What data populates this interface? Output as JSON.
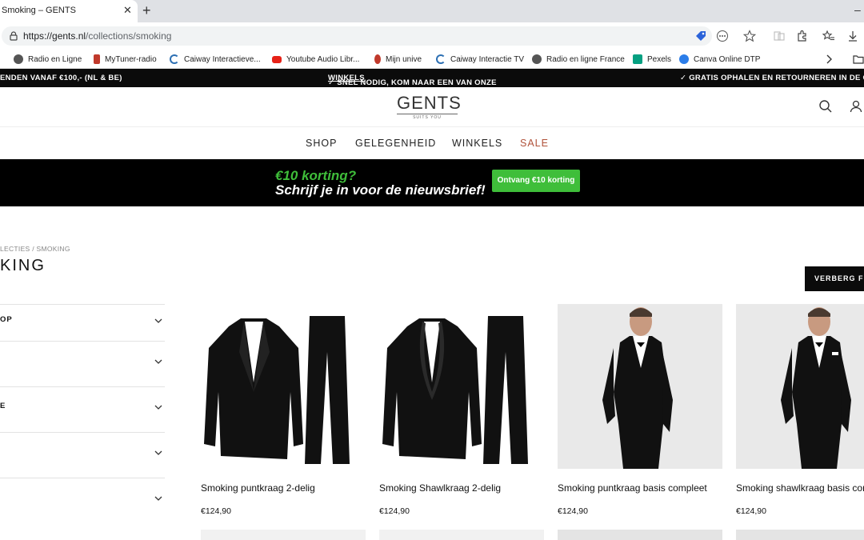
{
  "browser": {
    "tab_title": "Smoking – GENTS",
    "tab_close": "✕",
    "new_tab": "+",
    "minimize": "–",
    "url_host": "https://gents.nl",
    "url_path": "/collections/smoking",
    "bookmarks": [
      {
        "label": "Radio en Ligne",
        "icon": "radio-icon",
        "color": "#555"
      },
      {
        "label": "MyTuner-radio",
        "icon": "mytuner-icon",
        "color": "#c0392b"
      },
      {
        "label": "Caiway Interactieve...",
        "icon": "caiway-icon",
        "color": "#2c6fb3"
      },
      {
        "label": "Youtube Audio Libr...",
        "icon": "youtube-icon",
        "color": "#e62117"
      },
      {
        "label": "Mijn unive",
        "icon": "unive-icon",
        "color": "#c0392b"
      },
      {
        "label": "Caiway Interactie TV",
        "icon": "caiway-icon",
        "color": "#2c6fb3"
      },
      {
        "label": "Radio en ligne France",
        "icon": "radio-icon",
        "color": "#555"
      },
      {
        "label": "Pexels",
        "icon": "pexels-icon",
        "color": "#05a081"
      },
      {
        "label": "Canva Online DTP",
        "icon": "canva-icon",
        "color": "#2b7de9"
      }
    ]
  },
  "promo": {
    "left": "ENDEN VANAF €100,- (NL & BE)",
    "center_prefix": "✓ SNEL NODIG, KOM NAAR EEN VAN ONZE ",
    "center_link": "WINKELS",
    "right": "✓ GRATIS OPHALEN EN RETOURNEREN IN DE GE"
  },
  "header": {
    "logo": "GENTS",
    "logo_tagline": "SUITS YOU"
  },
  "nav": {
    "items": [
      "SHOP",
      "GELEGENHEID",
      "WINKELS",
      "SALE"
    ]
  },
  "newsletter": {
    "line1": "€10 korting?",
    "line2": "Schrijf je in voor de nieuwsbrief!",
    "button": "Ontvang €10 korting",
    "accent": "#3fbe3a"
  },
  "page": {
    "breadcrumb": "LECTIES  /  SMOKING",
    "title": "KING",
    "hide_filters": "VERBERG FI"
  },
  "filters": [
    "OP",
    "",
    "E",
    "",
    ""
  ],
  "products": [
    {
      "name": "Smoking puntkraag 2-delig",
      "price": "€124,90"
    },
    {
      "name": "Smoking Shawlkraag 2-delig",
      "price": "€124,90"
    },
    {
      "name": "Smoking puntkraag basis compleet",
      "price": "€124,90"
    },
    {
      "name": "Smoking shawlkraag basis com",
      "price": "€124,90"
    }
  ]
}
